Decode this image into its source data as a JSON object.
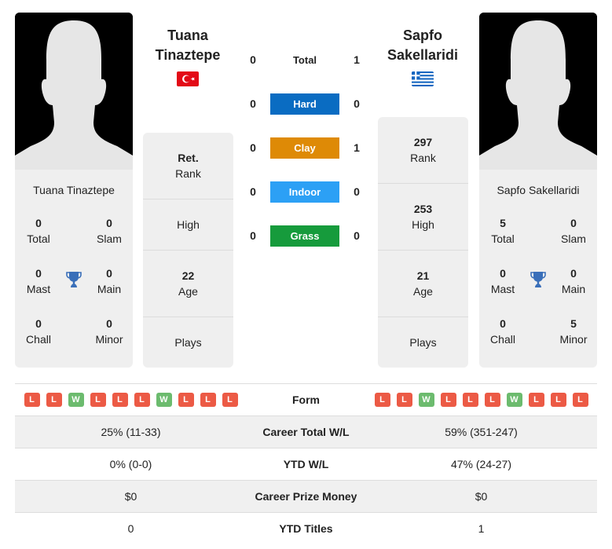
{
  "colors": {
    "hard": "#0a6cc2",
    "clay": "#de8a06",
    "indoor": "#2ca0f5",
    "grass": "#169b3c",
    "loss": "#ec5a45",
    "win": "#6cbb6e",
    "trophy": "#3a6fb9"
  },
  "player1": {
    "header_first": "Tuana",
    "header_last": "Tinaztepe",
    "flag": "turkey-flag",
    "full_name": "Tuana Tinaztepe",
    "titles": {
      "total": "0",
      "total_label": "Total",
      "slam": "0",
      "slam_label": "Slam",
      "mast": "0",
      "mast_label": "Mast",
      "main": "0",
      "main_label": "Main",
      "chall": "0",
      "chall_label": "Chall",
      "minor": "0",
      "minor_label": "Minor"
    },
    "stats": {
      "rank_value": "Ret.",
      "rank_label": "Rank",
      "high_value": "",
      "high_label": "High",
      "age_value": "22",
      "age_label": "Age",
      "plays_value": "",
      "plays_label": "Plays"
    },
    "form": [
      "L",
      "L",
      "W",
      "L",
      "L",
      "L",
      "W",
      "L",
      "L",
      "L"
    ]
  },
  "player2": {
    "header_first": "Sapfo",
    "header_last": "Sakellaridi",
    "flag": "greece-flag",
    "full_name": "Sapfo Sakellaridi",
    "titles": {
      "total": "5",
      "total_label": "Total",
      "slam": "0",
      "slam_label": "Slam",
      "mast": "0",
      "mast_label": "Mast",
      "main": "0",
      "main_label": "Main",
      "chall": "0",
      "chall_label": "Chall",
      "minor": "5",
      "minor_label": "Minor"
    },
    "stats": {
      "rank_value": "297",
      "rank_label": "Rank",
      "high_value": "253",
      "high_label": "High",
      "age_value": "21",
      "age_label": "Age",
      "plays_value": "",
      "plays_label": "Plays"
    },
    "form": [
      "L",
      "L",
      "W",
      "L",
      "L",
      "L",
      "W",
      "L",
      "L",
      "L"
    ]
  },
  "h2h": {
    "total": {
      "label": "Total",
      "p1": "0",
      "p2": "1"
    },
    "surfaces": [
      {
        "label": "Hard",
        "p1": "0",
        "p2": "0"
      },
      {
        "label": "Clay",
        "p1": "0",
        "p2": "1"
      },
      {
        "label": "Indoor",
        "p1": "0",
        "p2": "0"
      },
      {
        "label": "Grass",
        "p1": "0",
        "p2": "0"
      }
    ]
  },
  "comparison": {
    "form_label": "Form",
    "rows": [
      {
        "label": "Career Total W/L",
        "p1": "25% (11-33)",
        "p2": "59% (351-247)"
      },
      {
        "label": "YTD W/L",
        "p1": "0% (0-0)",
        "p2": "47% (24-27)"
      },
      {
        "label": "Career Prize Money",
        "p1": "$0",
        "p2": "$0"
      },
      {
        "label": "YTD Titles",
        "p1": "0",
        "p2": "1"
      }
    ]
  }
}
